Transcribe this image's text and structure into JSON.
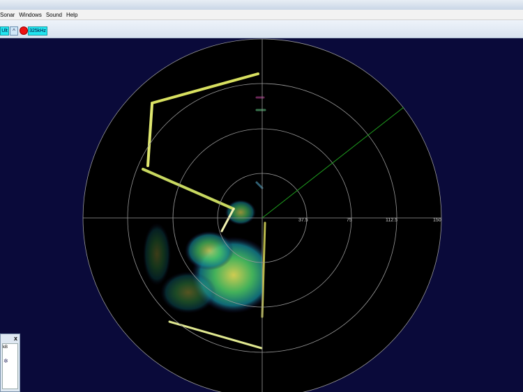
{
  "menu": {
    "items": [
      "Sonar",
      "Windows",
      "Sound",
      "Help"
    ]
  },
  "toolbar": {
    "ult_label": "Ult",
    "up_glyph": "^",
    "freq_label": "325kHz",
    "record_color": "#ee1111"
  },
  "sonar": {
    "range_labels": [
      "37.5",
      "75",
      "112.5",
      "150"
    ],
    "sweep_color": "#1fa01f",
    "ring_color": "#9a9a9a"
  },
  "panel": {
    "close_label": "x",
    "units_label": "kB",
    "icon": "gear-icon"
  }
}
